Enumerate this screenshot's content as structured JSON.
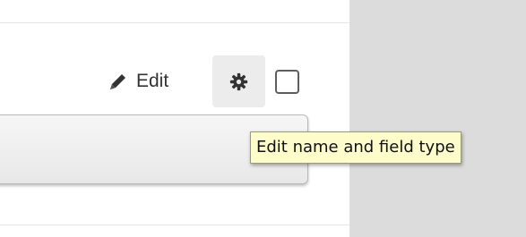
{
  "toolbar": {
    "edit_label": "Edit",
    "edit_icon": "pencil-icon",
    "settings_icon": "gear-icon",
    "checkbox_checked": false
  },
  "tooltip": {
    "text": "Edit name and field type"
  },
  "colors": {
    "sidebar_background": "#dcdcdc",
    "tooltip_background": "#fdfdcb",
    "settings_button_background": "#ececec"
  }
}
